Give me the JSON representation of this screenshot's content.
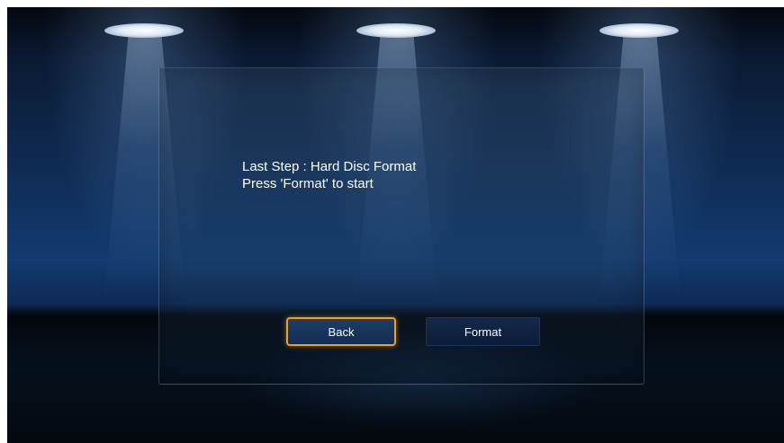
{
  "wizard": {
    "message_line1": "Last Step : Hard Disc Format",
    "message_line2": "Press 'Format' to start"
  },
  "buttons": {
    "back_label": "Back",
    "format_label": "Format",
    "focused": "Back"
  },
  "colors": {
    "focus_border": "#f0a020",
    "button_fill": "#142d52",
    "text": "#ffffff"
  }
}
